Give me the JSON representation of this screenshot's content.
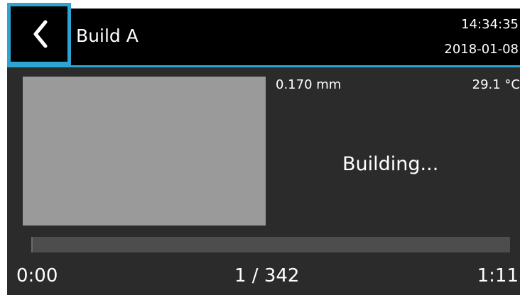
{
  "header": {
    "title": "Build A",
    "time": "14:34:35",
    "date": "2018-01-08",
    "back_icon": "chevron-left-icon"
  },
  "build": {
    "layer_thickness": "0.170 mm",
    "temperature": "29.1 °C",
    "status": "Building...",
    "progress_fraction": 0.003,
    "elapsed": "0:00",
    "layer_count": "1 / 342",
    "remaining": "1:11"
  },
  "colors": {
    "accent": "#2fa3d1",
    "background": "#2b2b2b",
    "header_bg": "#000000",
    "preview": "#9a9a9a",
    "progress_track": "#4d4d4d"
  }
}
